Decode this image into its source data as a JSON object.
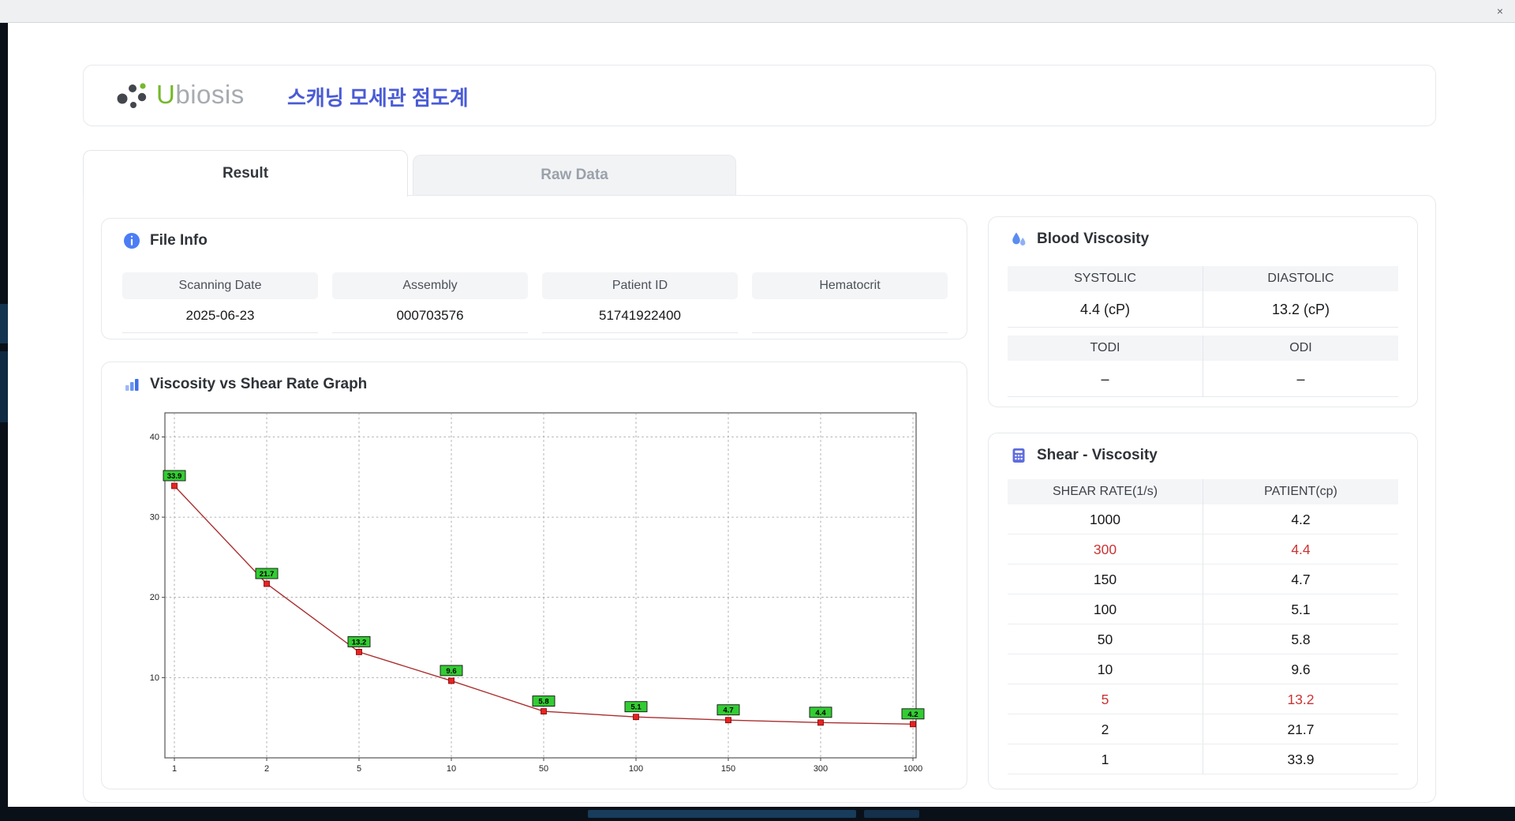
{
  "window": {
    "close_glyph": "×"
  },
  "icons": {
    "file_info": "info-circle-icon",
    "graph": "bar-chart-icon",
    "blood": "droplets-icon",
    "shear": "calculator-icon",
    "close": "close-x-icon",
    "logo": "dot-cluster-logo-icon"
  },
  "header": {
    "logo_u": "U",
    "logo_rest": "biosis",
    "title": "스캐닝 모세관 점도계"
  },
  "tabs": [
    {
      "label": "Result",
      "active": true
    },
    {
      "label": "Raw Data",
      "active": false
    }
  ],
  "file_info": {
    "title": "File Info",
    "fields": [
      {
        "label": "Scanning Date",
        "value": "2025-06-23"
      },
      {
        "label": "Assembly",
        "value": "000703576"
      },
      {
        "label": "Patient ID",
        "value": "51741922400"
      },
      {
        "label": "Hematocrit",
        "value": ""
      }
    ]
  },
  "blood_viscosity": {
    "title": "Blood Viscosity",
    "table1": {
      "headers": [
        "SYSTOLIC",
        "DIASTOLIC"
      ],
      "values": [
        "4.4 (cP)",
        "13.2 (cP)"
      ]
    },
    "table2": {
      "headers": [
        "TODI",
        "ODI"
      ],
      "values": [
        "–",
        "–"
      ]
    }
  },
  "graph": {
    "title": "Viscosity vs Shear Rate Graph"
  },
  "chart_data": {
    "type": "line",
    "title": "Viscosity vs Shear Rate Graph",
    "categories": [
      "1",
      "2",
      "5",
      "10",
      "50",
      "100",
      "150",
      "300",
      "1000"
    ],
    "values": [
      33.9,
      21.7,
      13.2,
      9.6,
      5.8,
      5.1,
      4.7,
      4.4,
      4.2
    ],
    "xlabel": "",
    "ylabel": "",
    "y_ticks": [
      10,
      20,
      30,
      40
    ],
    "ylim": [
      0,
      43
    ],
    "grid": "dashed",
    "line_color": "#aa2e2e",
    "marker_color": "#e82222",
    "label_bg": "#33cc33"
  },
  "shear_table": {
    "title": "Shear - Viscosity",
    "headers": [
      "SHEAR RATE(1/s)",
      "PATIENT(cp)"
    ],
    "rows": [
      {
        "shear": "1000",
        "patient": "4.2",
        "highlight": false
      },
      {
        "shear": "300",
        "patient": "4.4",
        "highlight": true
      },
      {
        "shear": "150",
        "patient": "4.7",
        "highlight": false
      },
      {
        "shear": "100",
        "patient": "5.1",
        "highlight": false
      },
      {
        "shear": "50",
        "patient": "5.8",
        "highlight": false
      },
      {
        "shear": "10",
        "patient": "9.6",
        "highlight": false
      },
      {
        "shear": "5",
        "patient": "13.2",
        "highlight": true
      },
      {
        "shear": "2",
        "patient": "21.7",
        "highlight": false
      },
      {
        "shear": "1",
        "patient": "33.9",
        "highlight": false
      }
    ]
  }
}
